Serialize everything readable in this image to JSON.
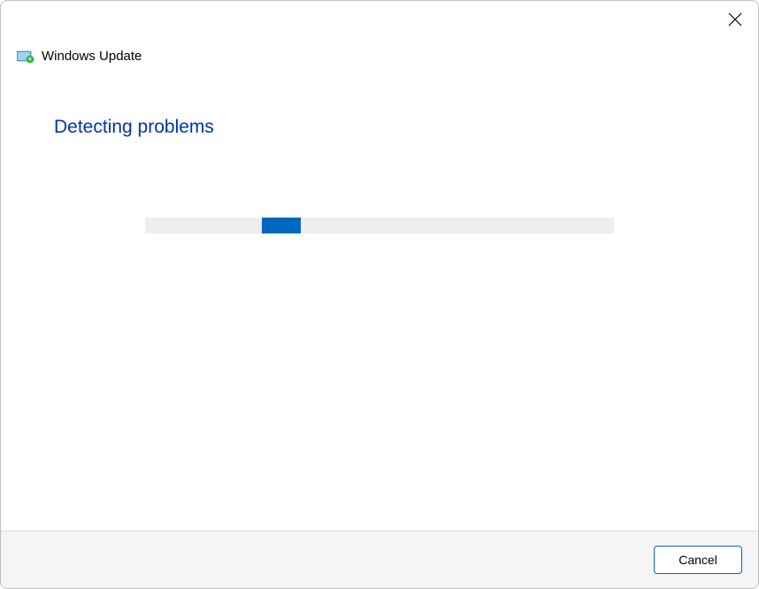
{
  "header": {
    "title": "Windows Update"
  },
  "main": {
    "heading": "Detecting problems"
  },
  "progress": {
    "indicator_left_percent": 25,
    "indicator_width_percent": 8
  },
  "footer": {
    "cancel_label": "Cancel"
  },
  "colors": {
    "accent": "#0067c0",
    "heading": "#0033aa",
    "progress_track": "#eeeeee",
    "footer_bg": "#f5f5f5"
  }
}
